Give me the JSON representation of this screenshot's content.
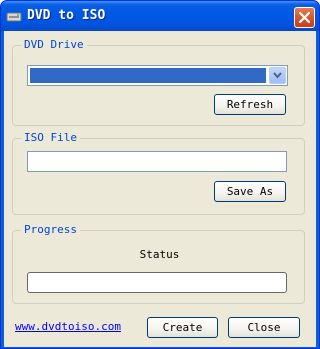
{
  "window": {
    "title": "DVD to ISO"
  },
  "dvd_drive": {
    "label": "DVD Drive",
    "selected": "",
    "refresh_label": "Refresh"
  },
  "iso_file": {
    "label": "ISO File",
    "path": "",
    "save_as_label": "Save As"
  },
  "progress": {
    "label": "Progress",
    "status": "Status",
    "value": 0
  },
  "footer": {
    "link": "www.dvdtoiso.com",
    "create_label": "Create",
    "close_label": "Close"
  },
  "colors": {
    "titlebar": "#0058e6",
    "group_label": "#0046d5",
    "selection": "#316ac5",
    "link": "#0000ff",
    "face": "#ece9d8"
  },
  "icons": {
    "app": "dvd-disc-icon",
    "close": "close-icon",
    "dropdown": "chevron-down-icon"
  }
}
